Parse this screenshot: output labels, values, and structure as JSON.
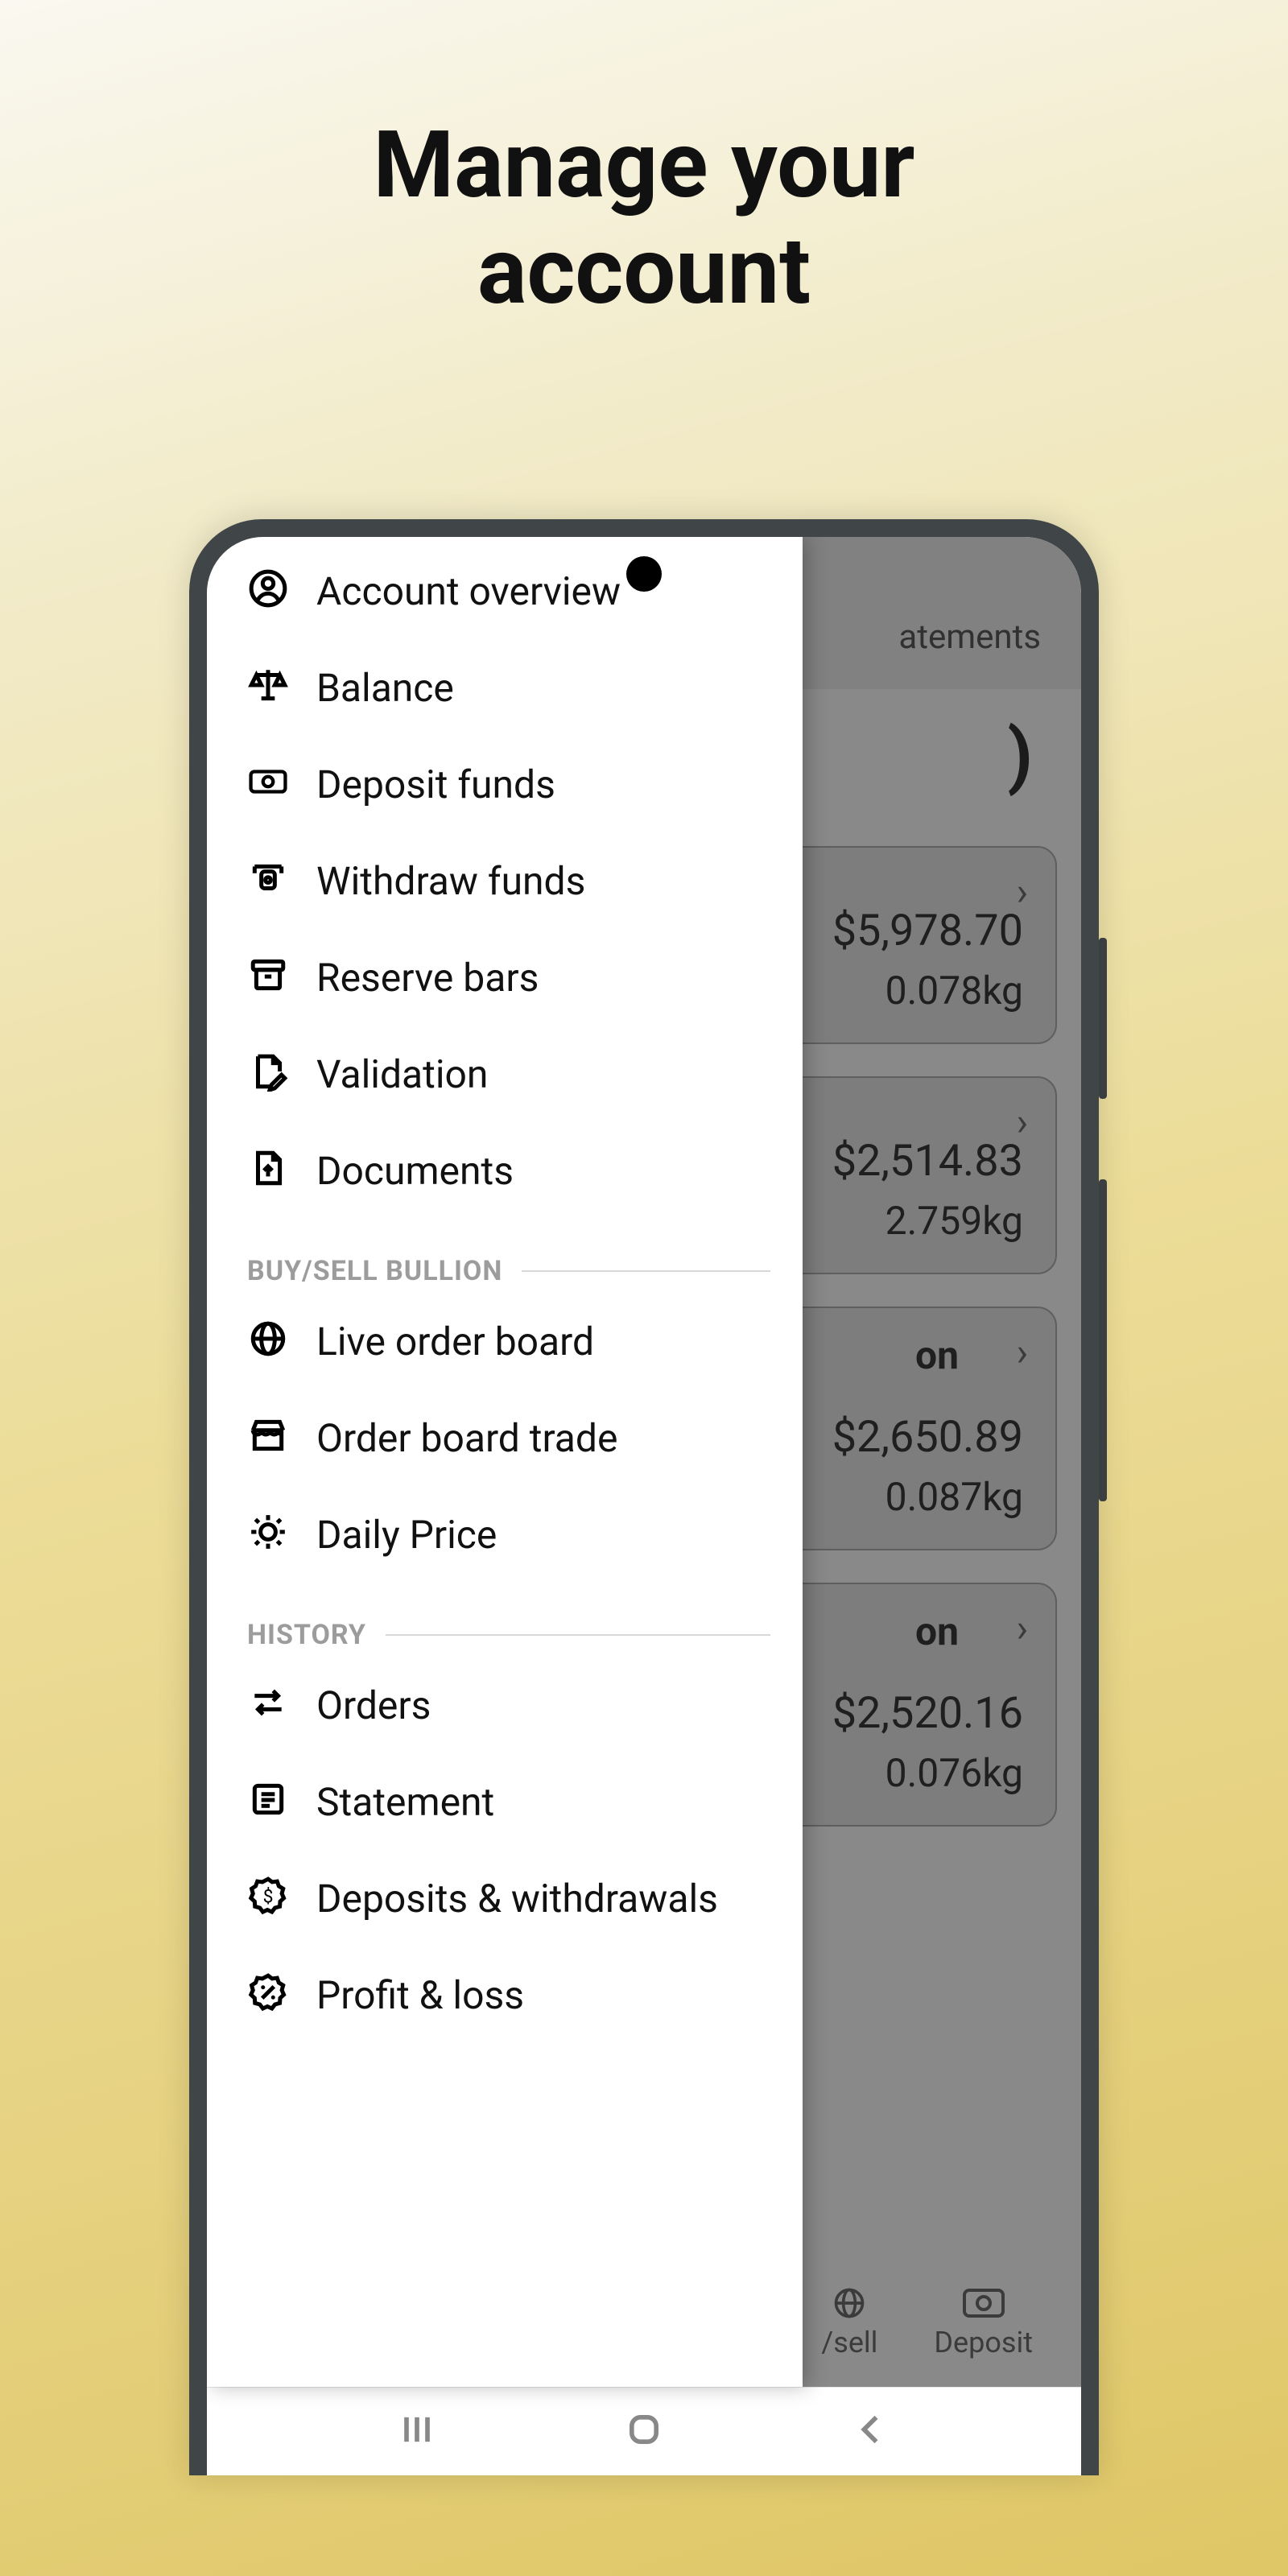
{
  "hero": {
    "title_l1": "Manage your",
    "title_l2": "account"
  },
  "menu": {
    "main": [
      {
        "label": "Account overview",
        "icon": "user-circle-icon"
      },
      {
        "label": "Balance",
        "icon": "scales-icon"
      },
      {
        "label": "Deposit funds",
        "icon": "cash-icon"
      },
      {
        "label": "Withdraw funds",
        "icon": "atm-icon"
      },
      {
        "label": "Reserve bars",
        "icon": "archive-icon"
      },
      {
        "label": "Validation",
        "icon": "edit-doc-icon"
      },
      {
        "label": "Documents",
        "icon": "upload-doc-icon"
      }
    ],
    "section1_title": "BUY/SELL BULLION",
    "buysell": [
      {
        "label": "Live order board",
        "icon": "globe-icon"
      },
      {
        "label": "Order board trade",
        "icon": "storefront-icon"
      },
      {
        "label": "Daily Price",
        "icon": "sun-gear-icon"
      }
    ],
    "section2_title": "HISTORY",
    "history": [
      {
        "label": "Orders",
        "icon": "swap-icon"
      },
      {
        "label": "Statement",
        "icon": "list-icon"
      },
      {
        "label": "Deposits & withdrawals",
        "icon": "dollar-badge-icon"
      },
      {
        "label": "Profit & loss",
        "icon": "percent-badge-icon"
      }
    ]
  },
  "underlay": {
    "tab_visible": "atements",
    "big_number_visible": ")",
    "cards": [
      {
        "label_visible": "",
        "amount": "$5,978.70",
        "weight": "0.078kg"
      },
      {
        "label_visible": "",
        "amount": "$2,514.83",
        "weight": "2.759kg"
      },
      {
        "label_visible": "on",
        "amount": "$2,650.89",
        "weight": "0.087kg"
      },
      {
        "label_visible": "on",
        "amount": "$2,520.16",
        "weight": "0.076kg"
      }
    ],
    "bottom": {
      "item1": "/sell",
      "item2": "Deposit"
    }
  }
}
